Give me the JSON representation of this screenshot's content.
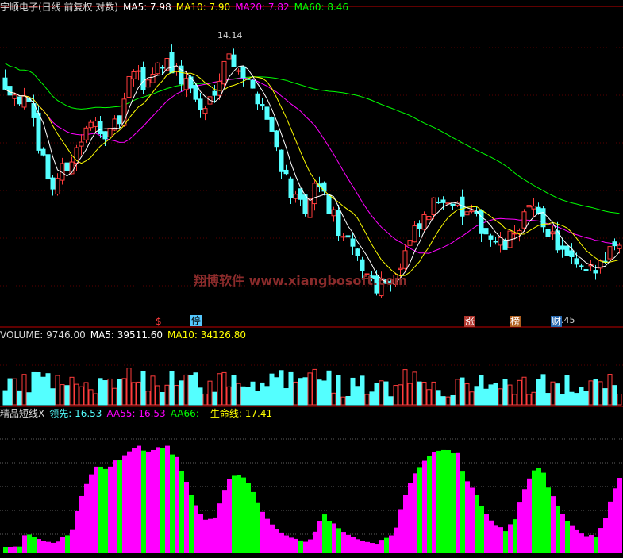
{
  "main_header": {
    "title": "宇顺电子(日线 前复权 对数)",
    "ma5": "MA5: 7.98",
    "ma10": "MA10: 7.90",
    "ma20": "MA20: 7.82",
    "ma60": "MA60: 8.46"
  },
  "volume_header": {
    "label": "VOLUME: 9746.00",
    "ma5": "MA5: 39511.60",
    "ma10": "MA10: 34126.80"
  },
  "indicator_header": {
    "name": "精品短线X",
    "lead": "领先: 16.53",
    "aa55": "AA55: 16.53",
    "aa66": "AA66: -",
    "life": "生命线: 17.41"
  },
  "watermark": "翔博软件 www.xiangbosoft.com",
  "annotations": {
    "high_price": "14.14",
    "low_price": "4.45"
  },
  "event_tags": [
    "$",
    "停",
    "涨",
    "榜",
    "财"
  ],
  "colors": {
    "background": "#000000",
    "up": "#ff3c3c",
    "down": "#54ffff",
    "ma5": "#ffffff",
    "ma10": "#ffff00",
    "ma20": "#ff00ff",
    "ma60": "#00ff00",
    "divider": "#c00000",
    "bull_area": "#ff00ff",
    "bear_area": "#00ff00"
  },
  "chart_data": [
    {
      "type": "candlestick",
      "title": "宇顺电子(日线 前复权 对数)",
      "series": [
        {
          "name": "MA5",
          "value": 7.98
        },
        {
          "name": "MA10",
          "value": 7.9
        },
        {
          "name": "MA20",
          "value": 7.82
        },
        {
          "name": "MA60",
          "value": 8.46
        }
      ],
      "price_range": [
        4.45,
        14.14
      ],
      "log_scale": true,
      "approx_closes": [
        11.2,
        10.6,
        10.0,
        8.4,
        7.0,
        7.6,
        8.2,
        9.0,
        9.4,
        8.8,
        9.6,
        11.8,
        11.0,
        12.0,
        12.4,
        11.4,
        11.0,
        9.6,
        10.8,
        12.6,
        12.2,
        11.0,
        10.4,
        9.0,
        7.6,
        6.6,
        6.3,
        7.2,
        6.4,
        5.7,
        5.3,
        4.9,
        4.6,
        4.7,
        4.9,
        5.6,
        6.0,
        6.5,
        6.9,
        6.4,
        6.2,
        6.0,
        5.6,
        5.4,
        5.8,
        6.4,
        6.2,
        5.8,
        5.3,
        5.0,
        4.8,
        4.9,
        5.4,
        5.6
      ],
      "grid": true
    },
    {
      "type": "bar",
      "title": "VOLUME",
      "series": [
        {
          "name": "VOLUME",
          "value": 9746.0
        },
        {
          "name": "MA5",
          "value": 39511.6
        },
        {
          "name": "MA10",
          "value": 34126.8
        }
      ]
    },
    {
      "type": "area",
      "title": "精品短线X",
      "series": [
        {
          "name": "领先",
          "value": 16.53
        },
        {
          "name": "AA55",
          "value": 16.53
        },
        {
          "name": "AA66",
          "value": "-"
        },
        {
          "name": "生命线",
          "value": 17.41
        }
      ]
    }
  ]
}
